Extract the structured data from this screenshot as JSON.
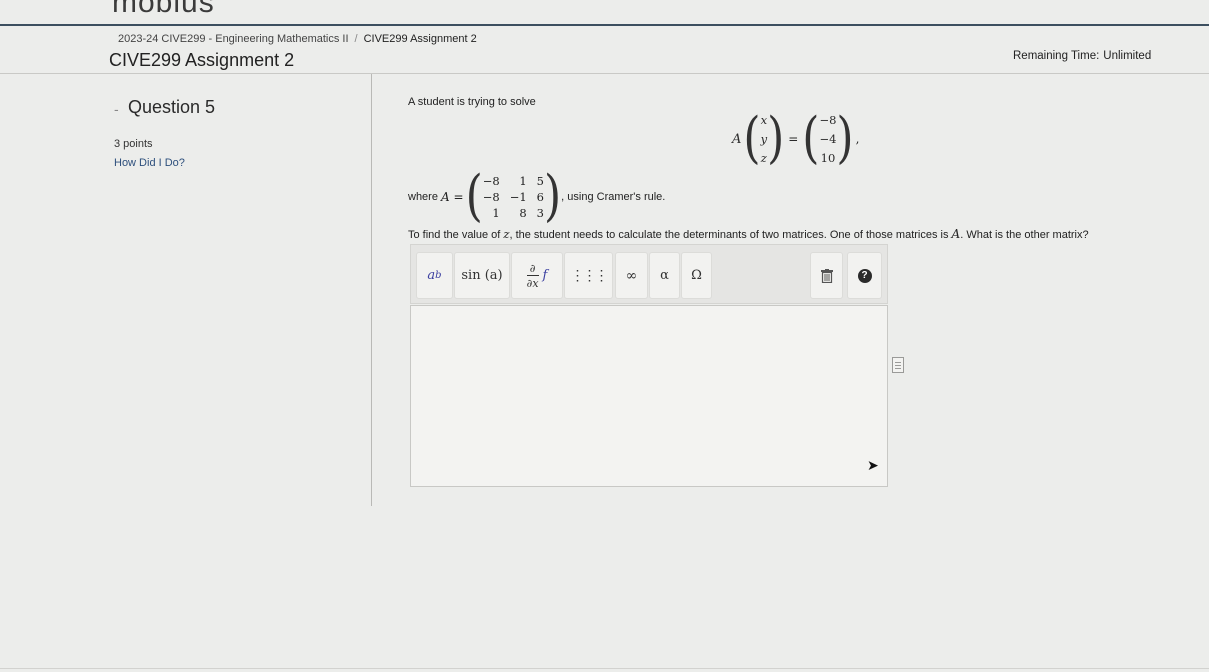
{
  "app": {
    "logo_text": "möbius"
  },
  "breadcrumb": {
    "course": "2023-24 CIVE299 - Engineering Mathematics II",
    "separator": "/",
    "current": "CIVE299 Assignment 2"
  },
  "page": {
    "title": "CIVE299 Assignment 2",
    "remaining_label": "Remaining Time:",
    "remaining_value": "Unlimited"
  },
  "question": {
    "collapse_symbol": "-",
    "title": "Question 5",
    "points": "3 points",
    "how_did_i_do": "How Did I Do?",
    "intro": "A student is trying to solve",
    "equation": {
      "lhs_letter": "A",
      "vector": [
        "x",
        "y",
        "z"
      ],
      "equals": "=",
      "rhs": [
        "−8",
        "−4",
        "10"
      ],
      "trailing": ","
    },
    "where_label": "where",
    "where_var": "A =",
    "matrix_A": [
      [
        "−8",
        "1",
        "5"
      ],
      [
        "−8",
        "−1",
        "6"
      ],
      [
        "1",
        "8",
        "3"
      ]
    ],
    "method_text": ", using Cramer's rule.",
    "prompt_pre": "To find the value of",
    "prompt_var": "z",
    "prompt_mid": ", the student needs to calculate the determinants of two matrices. One of those matrices is",
    "prompt_var2": "A",
    "prompt_post": ". What is the other matrix?"
  },
  "toolbar": {
    "superscript_base": "a",
    "superscript_exp": "b",
    "function_label": "sin (a)",
    "partial_num": "∂",
    "partial_den": "∂x",
    "partial_f": "f",
    "matrix_icon": "⋮⋮⋮",
    "infinity": "∞",
    "alpha": "α",
    "omega": "Ω",
    "trash_icon": "trash-icon",
    "help_icon": "?"
  },
  "answer": {
    "value": ""
  },
  "colors": {
    "accent": "#2d4f7c",
    "header_rule": "#3c4f5f",
    "background": "#ecedeb"
  }
}
